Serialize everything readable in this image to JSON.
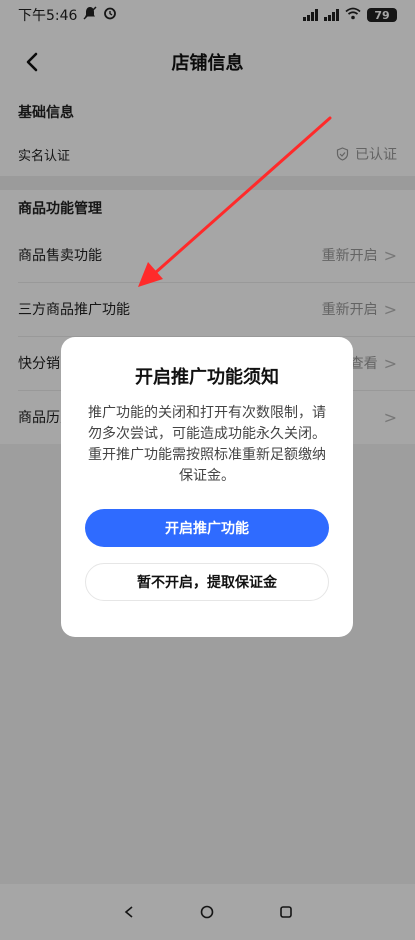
{
  "status_bar": {
    "time": "下午5:46",
    "battery": "79"
  },
  "header": {
    "title": "店铺信息"
  },
  "basic_info": {
    "title": "基础信息",
    "rows": [
      {
        "label": "实名认证",
        "status": "已认证"
      }
    ]
  },
  "product_mgmt": {
    "title": "商品功能管理",
    "rows": [
      {
        "label": "商品售卖功能",
        "action": "重新开启"
      },
      {
        "label": "三方商品推广功能",
        "action": "重新开启"
      },
      {
        "label": "快分销",
        "action": "查看"
      },
      {
        "label": "商品历史",
        "action": ""
      }
    ]
  },
  "modal": {
    "title": "开启推广功能须知",
    "text": "推广功能的关闭和打开有次数限制，请勿多次尝试，可能造成功能永久关闭。重开推广功能需按照标准重新足额缴纳保证金。",
    "primary_label": "开启推广功能",
    "secondary_label": "暂不开启，提取保证金"
  },
  "colors": {
    "accent": "#2f6bff",
    "arrow": "#ff2a2a"
  }
}
